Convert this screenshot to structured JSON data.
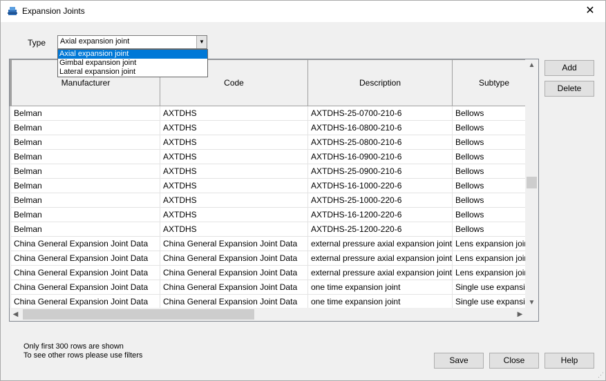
{
  "window": {
    "title": "Expansion Joints",
    "close_glyph": "✕"
  },
  "filter": {
    "type_label": "Type",
    "selected": "Axial expansion joint",
    "options": [
      "Axial expansion joint",
      "Gimbal expansion joint",
      "Lateral expansion joint"
    ]
  },
  "table": {
    "columns": [
      "Manufacturer",
      "Code",
      "Description",
      "Subtype"
    ],
    "rows": [
      [
        "Belman",
        "AXTDHS",
        "AXTDHS-25-0700-210-6",
        "Bellows"
      ],
      [
        "Belman",
        "AXTDHS",
        "AXTDHS-16-0800-210-6",
        "Bellows"
      ],
      [
        "Belman",
        "AXTDHS",
        "AXTDHS-25-0800-210-6",
        "Bellows"
      ],
      [
        "Belman",
        "AXTDHS",
        "AXTDHS-16-0900-210-6",
        "Bellows"
      ],
      [
        "Belman",
        "AXTDHS",
        "AXTDHS-25-0900-210-6",
        "Bellows"
      ],
      [
        "Belman",
        "AXTDHS",
        "AXTDHS-16-1000-220-6",
        "Bellows"
      ],
      [
        "Belman",
        "AXTDHS",
        "AXTDHS-25-1000-220-6",
        "Bellows"
      ],
      [
        "Belman",
        "AXTDHS",
        "AXTDHS-16-1200-220-6",
        "Bellows"
      ],
      [
        "Belman",
        "AXTDHS",
        "AXTDHS-25-1200-220-6",
        "Bellows"
      ],
      [
        "China General Expansion Joint Data",
        "China General Expansion Joint Data",
        "external pressure axial expansion joint",
        "Lens expansion joint"
      ],
      [
        "China General Expansion Joint Data",
        "China General Expansion Joint Data",
        "external pressure axial expansion joint",
        "Lens expansion joint"
      ],
      [
        "China General Expansion Joint Data",
        "China General Expansion Joint Data",
        "external pressure axial expansion joint",
        "Lens expansion joint"
      ],
      [
        "China General Expansion Joint Data",
        "China General Expansion Joint Data",
        "one time expansion joint",
        "Single use expansion"
      ],
      [
        "China General Expansion Joint Data",
        "China General Expansion Joint Data",
        "one time expansion joint",
        "Single use expansion"
      ]
    ]
  },
  "buttons": {
    "add": "Add",
    "delete": "Delete",
    "save": "Save",
    "close": "Close",
    "help": "Help"
  },
  "notes": {
    "line1": "Only first 300 rows are shown",
    "line2": "To see other rows please use filters"
  },
  "scroll": {
    "vertical_position": 0.47,
    "horizontal_visible_fraction": 0.45
  },
  "colors": {
    "selection": "#0078d7",
    "window_bg": "#f0f0f0"
  }
}
